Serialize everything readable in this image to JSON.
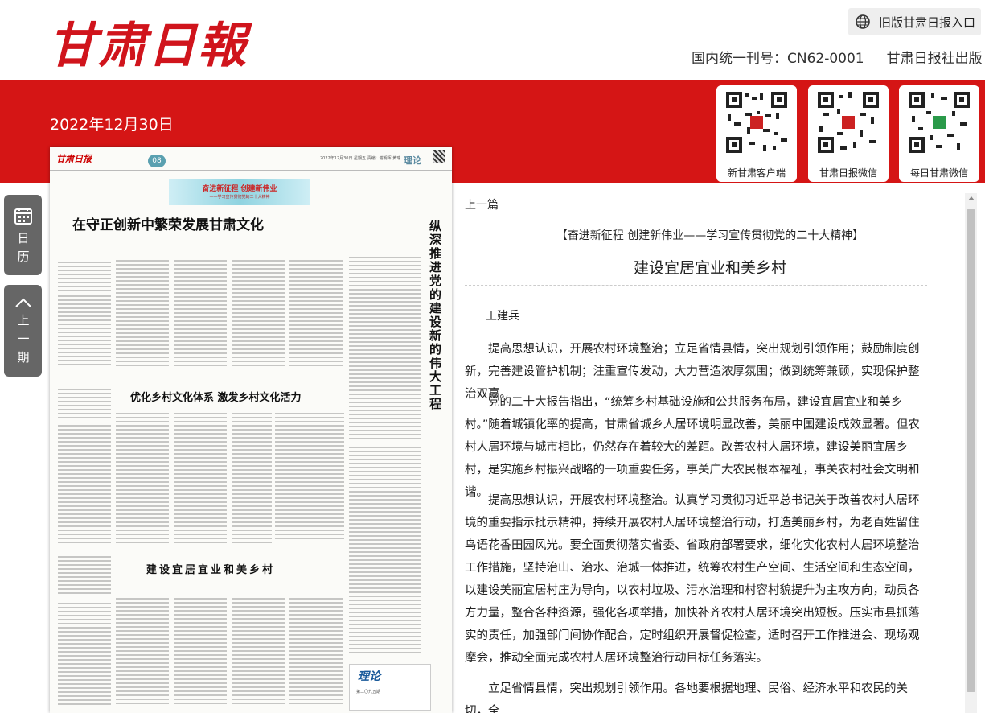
{
  "header": {
    "logo_text": "甘肃日報",
    "old_version_label": "旧版甘肃日报入口",
    "issn": "国内统一刊号：CN62-0001",
    "publisher": "甘肃日报社出版"
  },
  "date": "2022年12月30日",
  "qr_codes": [
    {
      "label": "新甘肃客户端"
    },
    {
      "label": "甘肃日报微信"
    },
    {
      "label": "每日甘肃微信"
    }
  ],
  "side_nav": {
    "calendar_label": "日历",
    "prev_issue_label": "上一期"
  },
  "newspaper_page": {
    "masthead": "甘肃日报",
    "page_number": "08",
    "info_line": "2022年12月30日 星期五 责编：谢朝晖 黄瑞",
    "column_name": "理论",
    "banner_main": "奋进新征程 创建新伟业",
    "banner_sub": "——学习宣传贯彻党的二十大精神",
    "headline_1": "在守正创新中繁荣发展甘肃文化",
    "headline_2": "优化乡村文化体系 激发乡村文化活力",
    "headline_3": "建设宜居宜业和美乡村",
    "vertical_headline": "纵深推进党的建设新的伟大工程",
    "badge_title": "理论",
    "badge_sub": "第二〇九五期"
  },
  "article": {
    "prev_link": "上一篇",
    "kicker": "【奋进新征程 创建新伟业——学习宣传贯彻党的二十大精神】",
    "title": "建设宜居宜业和美乡村",
    "author": "王建兵",
    "paragraphs": [
      "提高思想认识，开展农村环境整治；立足省情县情，突出规划引领作用；鼓励制度创新，完善建设管护机制；注重宣传发动，大力营造浓厚氛围；做到统筹兼顾，实现保护整治双赢。",
      "党的二十大报告指出，“统筹乡村基础设施和公共服务布局，建设宜居宜业和美乡村。”随着城镇化率的提高，甘肃省城乡人居环境明显改善，美丽中国建设成效显著。但农村人居环境与城市相比，仍然存在着较大的差距。改善农村人居环境，建设美丽宜居乡村，是实施乡村振兴战略的一项重要任务，事关广大农民根本福祉，事关农村社会文明和谐。",
      "提高思想认识，开展农村环境整治。认真学习贯彻习近平总书记关于改善农村人居环境的重要指示批示精神，持续开展农村人居环境整治行动，打造美丽乡村，为老百姓留住鸟语花香田园风光。要全面贯彻落实省委、省政府部署要求，细化实化农村人居环境整治工作措施，坚持治山、治水、治城一体推进，统筹农村生产空间、生活空间和生态空间，以建设美丽宜居村庄为导向，以农村垃圾、污水治理和村容村貌提升为主攻方向，动员各方力量，整合各种资源，强化各项举措，加快补齐农村人居环境突出短板。压实市县抓落实的责任，加强部门间协作配合，定时组织开展督促检查，适时召开工作推进会、现场观摩会，推动全面完成农村人居环境整治行动目标任务落实。",
      "立足省情县情，突出规划引领作用。各地要根据地理、民俗、经济水平和农民的关切，全"
    ]
  }
}
